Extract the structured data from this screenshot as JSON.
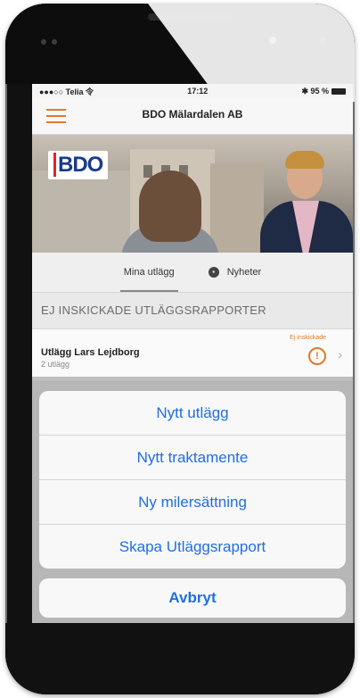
{
  "status_bar": {
    "carrier": "●●●○○ Telia 令",
    "time": "17:12",
    "battery": "✱ 95 %"
  },
  "navbar": {
    "title": "BDO Mälardalen AB"
  },
  "hero": {
    "logo_text": "BDO"
  },
  "segments": [
    {
      "label": "Mina utlägg"
    },
    {
      "label": "Nyheter"
    }
  ],
  "section": {
    "header": "EJ INSKICKADE UTLÄGGSRAPPORTER"
  },
  "report_row": {
    "title": "Utlägg Lars Lejdborg",
    "subtitle": "2 utlägg",
    "status": "Ej inskickade",
    "warning": "!"
  },
  "action_sheet": {
    "items": [
      {
        "label": "Nytt utlägg"
      },
      {
        "label": "Nytt traktamente"
      },
      {
        "label": "Ny milersättning"
      },
      {
        "label": "Skapa Utläggsrapport"
      }
    ],
    "cancel_label": "Avbryt"
  },
  "colors": {
    "accent": "#1f6fe0",
    "brand_orange": "#e07b2a",
    "bdo_blue": "#1a3a8a",
    "bdo_red": "#d9262c"
  }
}
